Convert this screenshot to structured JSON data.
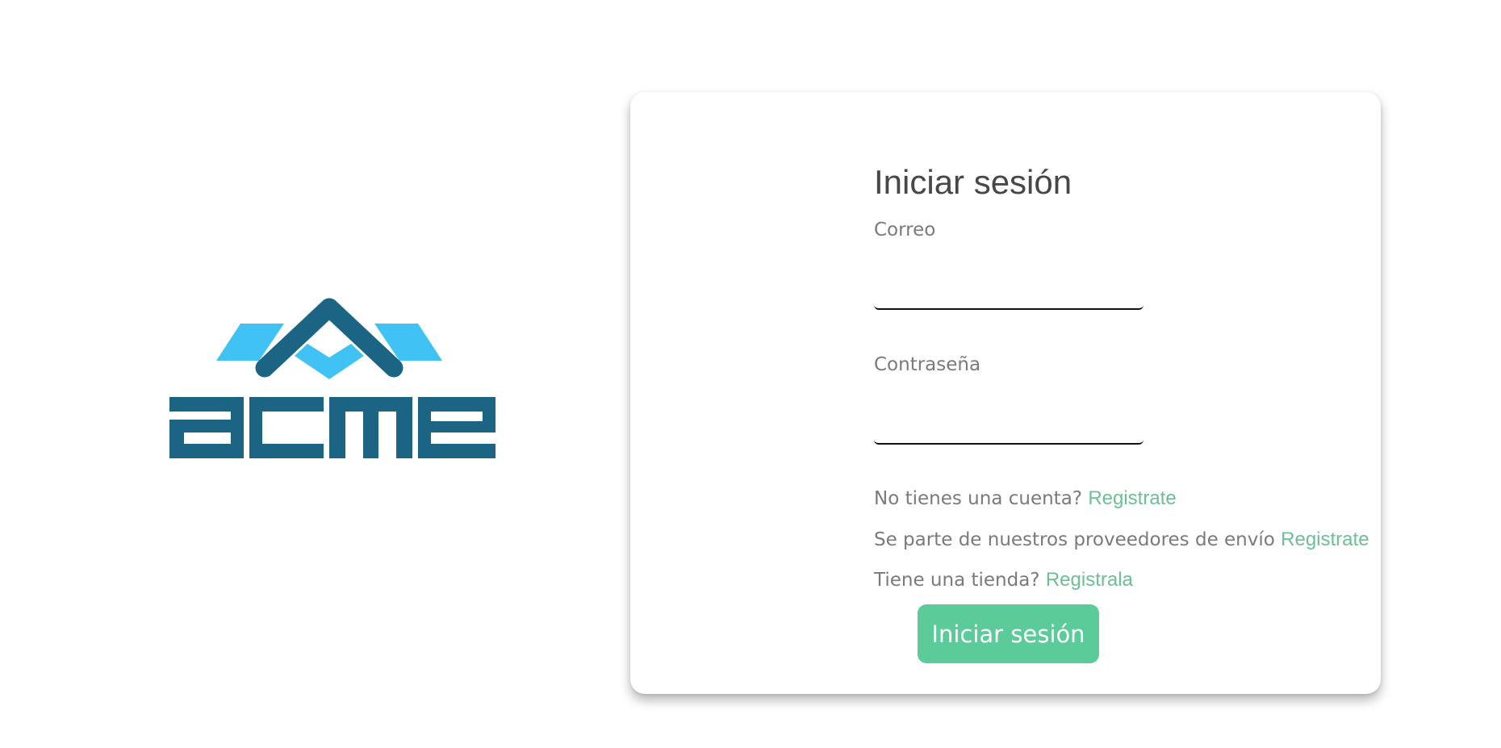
{
  "logo": {
    "text": "acme",
    "colors": {
      "primary": "#1b6483",
      "accent": "#40c2f5"
    }
  },
  "login": {
    "title": "Iniciar sesión",
    "email_label": "Correo",
    "email_value": "",
    "password_label": "Contraseña",
    "password_value": "",
    "no_account_text": "No tienes una cuenta?",
    "no_account_link": "Registrate",
    "provider_text": "Se parte de nuestros proveedores de envío",
    "provider_link": "Registrate",
    "store_text": "Tiene una tienda?",
    "store_link": "Registrala",
    "submit_label": "Iniciar sesión"
  },
  "colors": {
    "link": "#6cbf97",
    "button": "#5ccb9a",
    "title": "#474747",
    "label": "#7a7a7a"
  }
}
